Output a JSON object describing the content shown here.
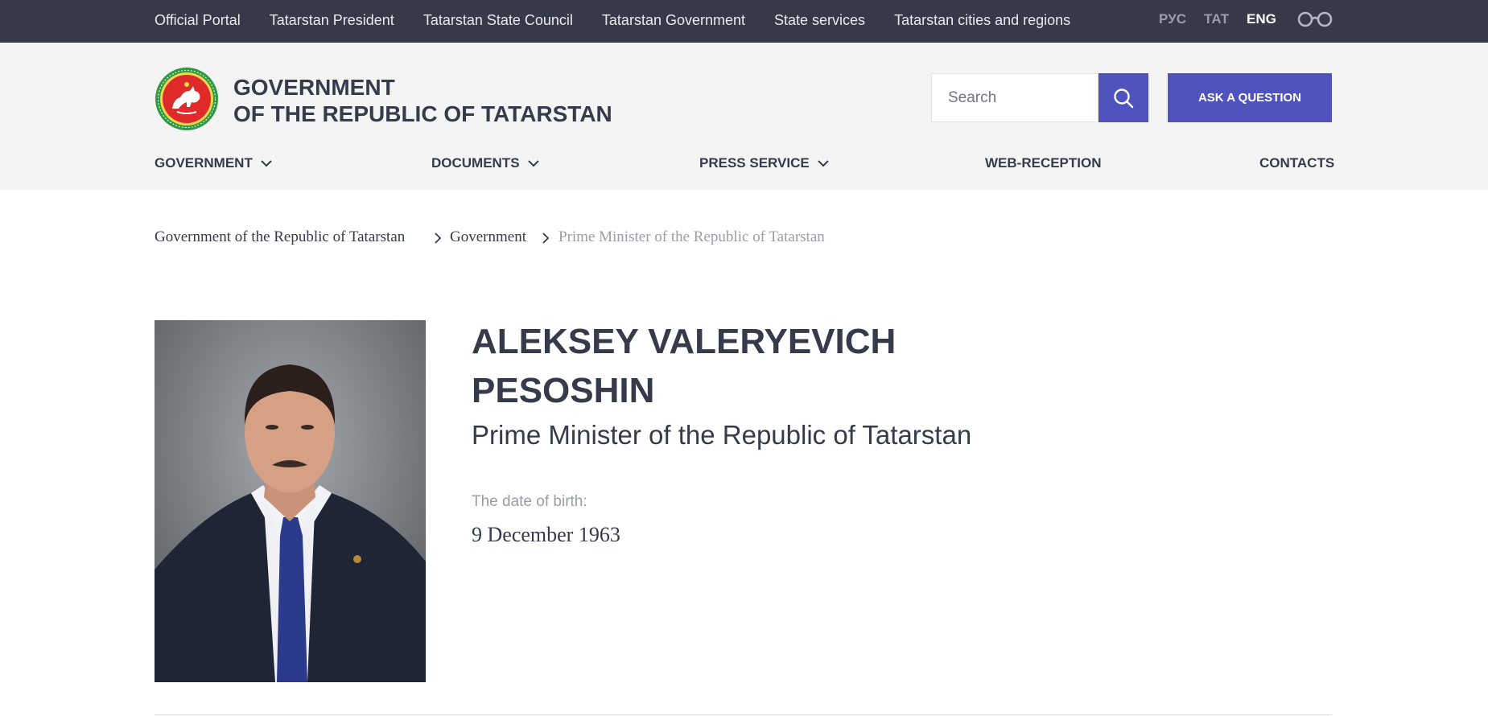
{
  "topbar": {
    "links": [
      "Official Portal",
      "Tatarstan President",
      "Tatarstan State Council",
      "Tatarstan Government",
      "State services",
      "Tatarstan cities and regions"
    ],
    "languages": [
      "РУС",
      "ТАТ",
      "ENG"
    ],
    "active_language": "ENG",
    "accessibility_icon": "glasses-icon"
  },
  "header": {
    "brand_line1": "GOVERNMENT",
    "brand_line2": "OF THE REPUBLIC OF TATARSTAN",
    "emblem_icon": "tatarstan-emblem-icon",
    "search_placeholder": "Search",
    "search_icon": "search-icon",
    "ask_label": "ASK A QUESTION",
    "accent_color": "#5053bd"
  },
  "nav": {
    "items": [
      {
        "label": "GOVERNMENT",
        "has_dropdown": true
      },
      {
        "label": "DOCUMENTS",
        "has_dropdown": true
      },
      {
        "label": "PRESS SERVICE",
        "has_dropdown": true
      },
      {
        "label": "WEB-RECEPTION",
        "has_dropdown": false
      },
      {
        "label": "CONTACTS",
        "has_dropdown": false
      }
    ]
  },
  "breadcrumb": [
    "Government of the Republic of Tatarstan",
    "Government",
    "Prime Minister of the Republic of Tatarstan"
  ],
  "profile": {
    "name_line1": "ALEKSEY VALERYEVICH",
    "name_line2": "PESOSHIN",
    "position": "Prime Minister of the Republic of Tatarstan",
    "dob_label": "The date of birth:",
    "dob_value": "9 December 1963"
  }
}
